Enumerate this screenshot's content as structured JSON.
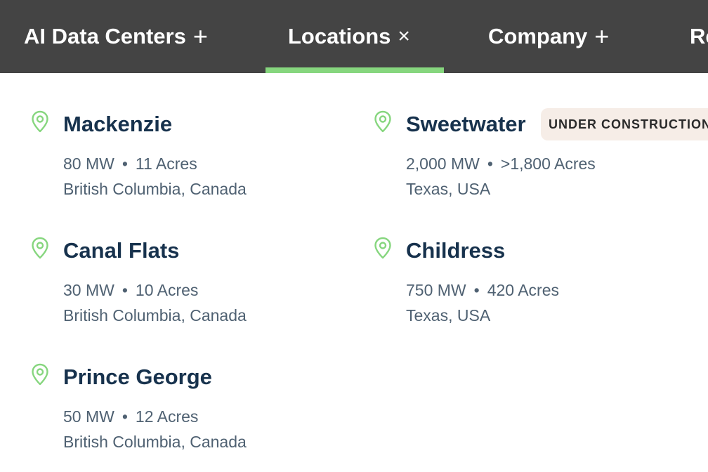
{
  "nav": {
    "items": [
      {
        "label": "AI Data Centers",
        "glyph": "+",
        "icon": "plus-icon"
      },
      {
        "label": "Locations",
        "glyph": "×",
        "icon": "close-icon"
      },
      {
        "label": "Company",
        "glyph": "+",
        "icon": "plus-icon"
      },
      {
        "label": "Re"
      }
    ],
    "active_index": 1,
    "accent_color": "#86d67e",
    "background_color": "#444444"
  },
  "locations": [
    {
      "name": "Mackenzie",
      "capacity": "80 MW",
      "area": "11 Acres",
      "region": "British Columbia, Canada"
    },
    {
      "name": "Canal Flats",
      "capacity": "30 MW",
      "area": "10 Acres",
      "region": "British Columbia, Canada"
    },
    {
      "name": "Prince George",
      "capacity": "50 MW",
      "area": "12 Acres",
      "region": "British Columbia, Canada"
    },
    {
      "name": "Sweetwater",
      "capacity": "2,000 MW",
      "area": ">1,800 Acres",
      "region": "Texas, USA",
      "badge": "UNDER CONSTRUCTION"
    },
    {
      "name": "Childress",
      "capacity": "750 MW",
      "area": "420 Acres",
      "region": "Texas, USA"
    }
  ],
  "separator": "•",
  "colors": {
    "pin": "#86d67e",
    "title": "#17324d",
    "text": "#4f6172",
    "badge_background": "#f6ede7"
  }
}
